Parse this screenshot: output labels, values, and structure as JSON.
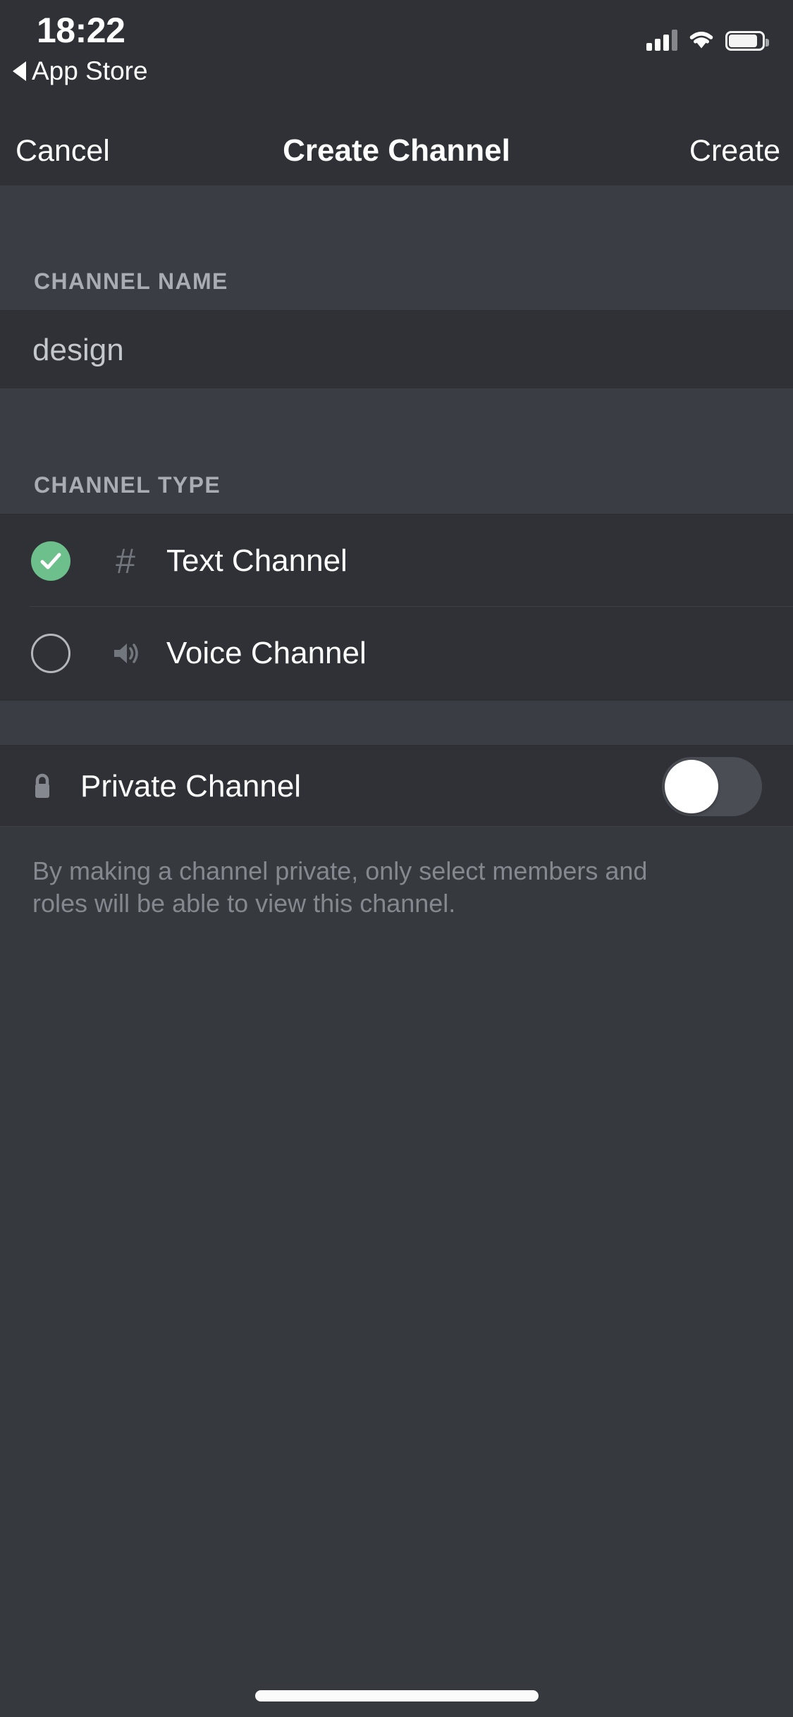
{
  "status_bar": {
    "time": "18:22",
    "back_label": "App Store",
    "back_icon": "triangle-left-icon",
    "signal_icon": "cellular-signal-icon",
    "wifi_icon": "wifi-icon",
    "battery_icon": "battery-icon"
  },
  "navbar": {
    "cancel_label": "Cancel",
    "title": "Create Channel",
    "create_label": "Create"
  },
  "channel_name": {
    "section_label": "CHANNEL NAME",
    "value": "design",
    "placeholder": "design"
  },
  "channel_type": {
    "section_label": "CHANNEL TYPE",
    "options": [
      {
        "label": "Text Channel",
        "icon": "hash-icon",
        "glyph": "#",
        "selected": true
      },
      {
        "label": "Voice Channel",
        "icon": "speaker-icon",
        "glyph": "",
        "selected": false
      }
    ]
  },
  "private_channel": {
    "label": "Private Channel",
    "icon": "lock-icon",
    "toggle_state": "off",
    "description": "By making a channel private, only select members and roles will be able to view this channel."
  },
  "colors": {
    "accent_green": "#6DBF8B",
    "background": "#36393E",
    "row_background": "#2F3136",
    "section_background": "#3A3D43",
    "muted_text": "#85888E",
    "label_text": "#A9ADB3"
  }
}
